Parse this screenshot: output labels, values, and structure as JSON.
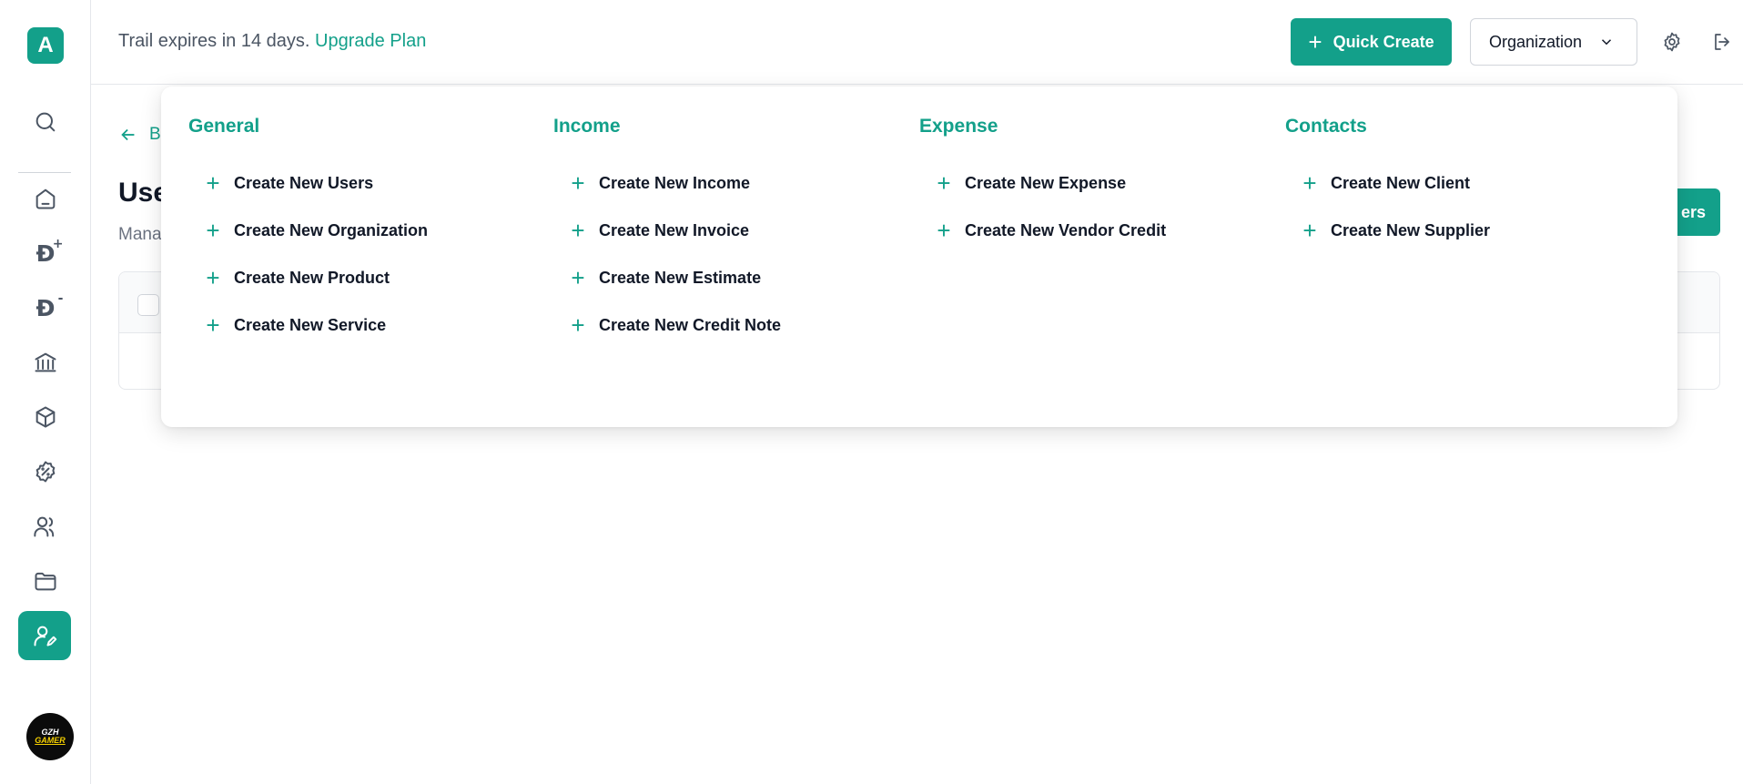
{
  "sidebar": {
    "logo_letter": "A",
    "icons": [
      "search-icon",
      "home-icon",
      "income-icon",
      "expense-icon",
      "bank-icon",
      "box-icon",
      "discount-icon",
      "users-icon",
      "folder-icon",
      "user-edit-icon"
    ],
    "dirham_symbol": "Đ",
    "plus_sign": "+",
    "minus_sign": "-",
    "avatar_line1": "GZH",
    "avatar_line2": "GAMER"
  },
  "header": {
    "trial_text": "Trail expires in 14 days.",
    "upgrade_link": "Upgrade Plan",
    "quick_create_label": "Quick Create",
    "quick_create_plus": "+",
    "organization_label": "Organization"
  },
  "page": {
    "back_label": "B",
    "title": "Use",
    "subtitle": "Mana",
    "right_button_label": "ers"
  },
  "quick_create_menu": {
    "columns": [
      {
        "title": "General",
        "items": [
          "Create New Users",
          "Create New Organization",
          "Create New Product",
          "Create New Service"
        ]
      },
      {
        "title": "Income",
        "items": [
          "Create New Income",
          "Create New Invoice",
          "Create New Estimate",
          "Create New Credit Note"
        ]
      },
      {
        "title": "Expense",
        "items": [
          "Create New Expense",
          "Create New Vendor Credit"
        ]
      },
      {
        "title": "Contacts",
        "items": [
          "Create New Client",
          "Create New Supplier"
        ]
      }
    ],
    "plus_glyph": "+"
  },
  "colors": {
    "accent": "#13a08a",
    "text": "#111827",
    "muted": "#4b5563"
  }
}
